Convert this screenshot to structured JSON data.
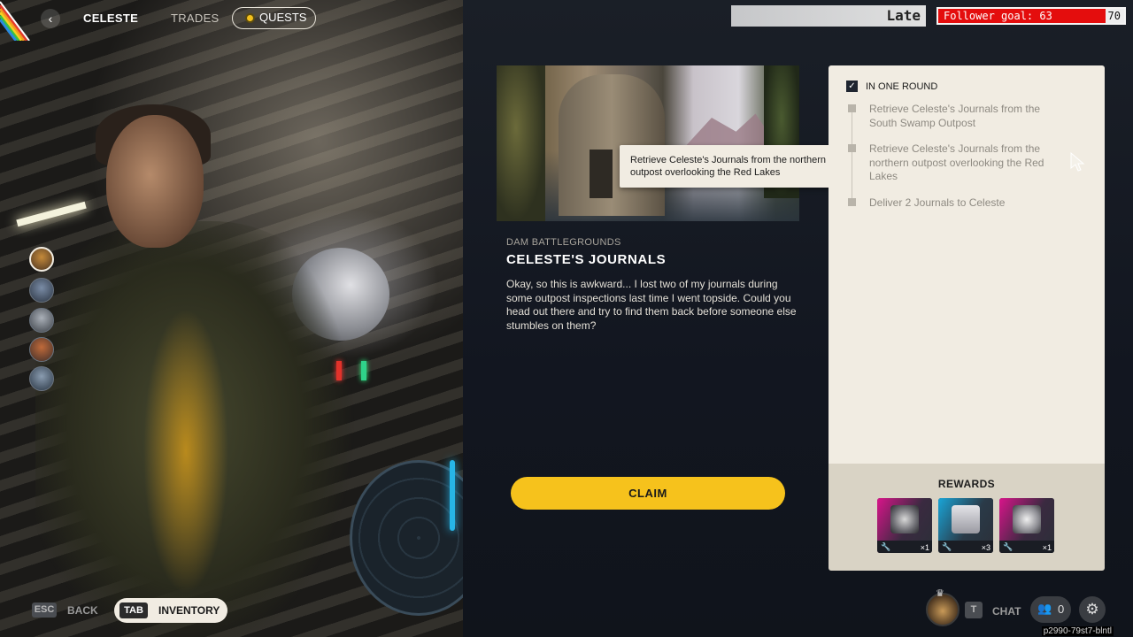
{
  "nav": {
    "back_icon": "chevron-left-icon",
    "merchant_name": "CELESTE",
    "tab_trades": "TRADES",
    "tab_quests": "QUESTS"
  },
  "stream_overlay": {
    "late_label": "Late",
    "follower_text": "Follower goal: 63",
    "follower_max": "70",
    "follower_progress": 0.9,
    "bar_color": "#e40d0d"
  },
  "quest": {
    "zone": "DAM BATTLEGROUNDS",
    "title": "CELESTE'S JOURNALS",
    "description": "Okay, so this is awkward... I lost two of my journals during some outpost inspections last time I went topside. Could you head out there and try to find them back before someone else stumbles on them?",
    "tooltip": "Retrieve Celeste's Journals from the northern outpost overlooking the Red Lakes",
    "claim_label": "CLAIM",
    "accent_color": "#f6c21c"
  },
  "objectives": {
    "header": "IN ONE ROUND",
    "items": [
      "Retrieve Celeste's Journals from the South Swamp Outpost",
      "Retrieve Celeste's Journals from the northern outpost overlooking the Red Lakes",
      "Deliver 2 Journals to Celeste"
    ]
  },
  "rewards": {
    "title": "REWARDS",
    "items": [
      {
        "name": "reward-item-1",
        "quantity": "×1",
        "rarity_color": "#d9148a"
      },
      {
        "name": "reward-item-2",
        "quantity": "×3",
        "rarity_color": "#19a5d8"
      },
      {
        "name": "reward-item-3",
        "quantity": "×1",
        "rarity_color": "#d9148a"
      }
    ]
  },
  "footer": {
    "esc_key": "ESC",
    "back_label": "BACK",
    "tab_key": "TAB",
    "inventory_label": "INVENTORY",
    "chat_key": "T",
    "chat_label": "CHAT",
    "party_count": "0",
    "build_id": "p2990-79st7-blntl"
  }
}
